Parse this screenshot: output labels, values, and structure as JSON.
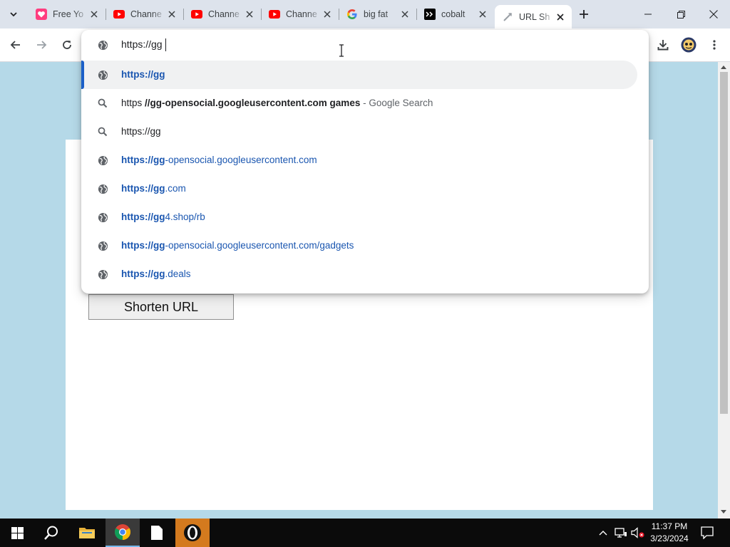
{
  "browser": {
    "tabs": [
      {
        "title": "Free Yo",
        "favicon": "heart-app-icon"
      },
      {
        "title": "Channe",
        "favicon": "youtube-icon"
      },
      {
        "title": "Channe",
        "favicon": "youtube-icon"
      },
      {
        "title": "Channe",
        "favicon": "youtube-icon"
      },
      {
        "title": "big fat",
        "favicon": "google-icon"
      },
      {
        "title": "cobalt",
        "favicon": "cobalt-icon"
      },
      {
        "title": "URL Sh",
        "favicon": "link-icon",
        "active": true
      }
    ]
  },
  "omnibox": {
    "value": "https://gg",
    "suggestions": [
      {
        "type": "url",
        "bold": "https://gg",
        "rest": ""
      },
      {
        "type": "search",
        "a": "https ",
        "b": "//gg-opensocial.googleusercontent.com games",
        "c": " - Google Search"
      },
      {
        "type": "search",
        "a": "https://gg"
      },
      {
        "type": "url",
        "bold": "https://gg",
        "rest": "-opensocial.googleusercontent.com"
      },
      {
        "type": "url",
        "bold": "https://gg",
        "rest": ".com"
      },
      {
        "type": "url",
        "bold": "https://gg",
        "rest": "4.shop/rb"
      },
      {
        "type": "url",
        "bold": "https://gg",
        "rest": "-opensocial.googleusercontent.com/gadgets"
      },
      {
        "type": "url",
        "bold": "https://gg",
        "rest": ".deals"
      }
    ]
  },
  "page": {
    "shorten_label": "Shorten URL"
  },
  "taskbar": {
    "time": "11:37 PM",
    "date": "3/23/2024"
  },
  "colors": {
    "accent": "#1a5fc8",
    "page_bg": "#b5d9e8",
    "link": "#1a56b0"
  }
}
